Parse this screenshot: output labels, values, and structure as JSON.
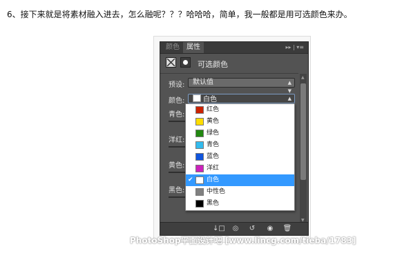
{
  "article": {
    "heading": "6、接下来就是将素材融入进去，怎么融呢？？？哈哈哈，简单，我一般都是用可选颜色来办。"
  },
  "panel": {
    "tabs": [
      {
        "label": "颜色",
        "active": false
      },
      {
        "label": "属性",
        "active": true
      }
    ],
    "tab_tools": "▸▸ | ▾≡",
    "title": "可选颜色",
    "preset_label": "预设:",
    "preset_value": "默认值",
    "colors_label": "颜色:",
    "colors_value": "白色",
    "sliders": [
      {
        "label": "青色:"
      },
      {
        "label": "洋红:"
      },
      {
        "label": "黄色:"
      },
      {
        "label": "黑色:"
      }
    ]
  },
  "dropdown": {
    "items": [
      {
        "label": "红色",
        "color": "#cc2200",
        "selected": false
      },
      {
        "label": "黄色",
        "color": "#ffdd00",
        "selected": false
      },
      {
        "label": "绿色",
        "color": "#228811",
        "selected": false
      },
      {
        "label": "青色",
        "color": "#33bbee",
        "selected": false
      },
      {
        "label": "蓝色",
        "color": "#1155dd",
        "selected": false
      },
      {
        "label": "洋红",
        "color": "#cc22bb",
        "selected": false
      },
      {
        "label": "白色",
        "color": "#ffffff",
        "selected": true
      },
      {
        "label": "中性色",
        "color": "#808080",
        "selected": false
      },
      {
        "label": "黑色",
        "color": "#000000",
        "selected": false
      }
    ]
  },
  "watermark": "PhotoShop平面设计吧 [www.lincg.com/tieba/1783]",
  "colors": {
    "panel_bg": "#535353",
    "selection": "#3399ff"
  }
}
